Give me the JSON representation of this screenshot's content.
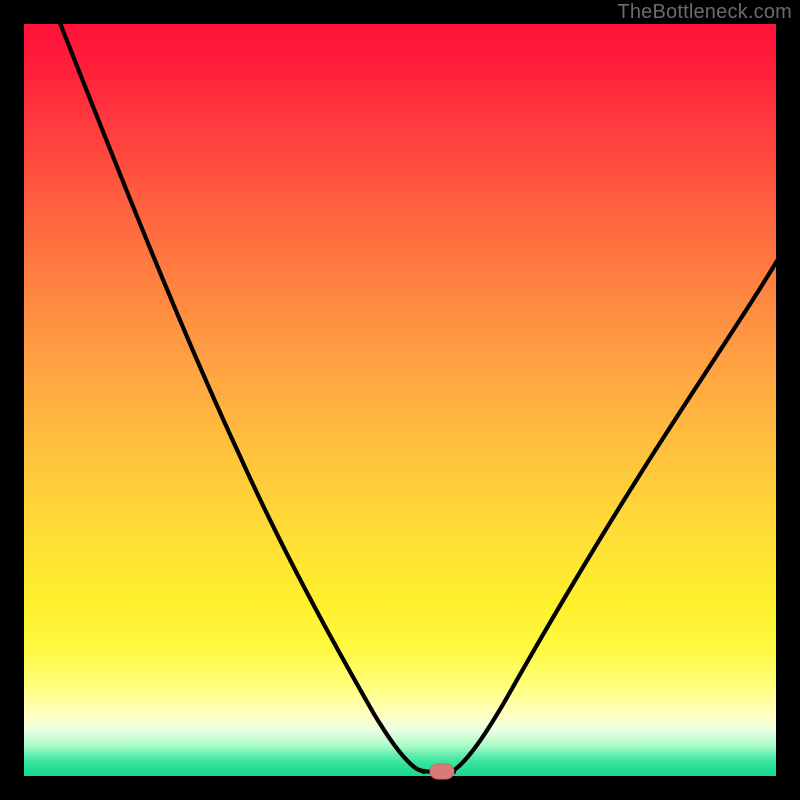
{
  "watermark": "TheBottleneck.com",
  "colors": {
    "frame": "#000000",
    "curve_stroke": "#000000",
    "marker_fill": "#d77a7a",
    "gradient_top": "#ff1239",
    "gradient_bottom": "#1bd98f"
  },
  "chart_data": {
    "type": "line",
    "title": "",
    "xlabel": "",
    "ylabel": "",
    "xlim": [
      0,
      100
    ],
    "ylim": [
      0,
      100
    ],
    "x": [
      0,
      5,
      10,
      15,
      20,
      25,
      30,
      35,
      40,
      45,
      48,
      50,
      52,
      54,
      56,
      58,
      60,
      65,
      70,
      75,
      80,
      85,
      90,
      95,
      100
    ],
    "y_percent_from_top": [
      0,
      11,
      22,
      33,
      43,
      53,
      62,
      71,
      80,
      89,
      94,
      97,
      99,
      100,
      100,
      99,
      96,
      88,
      79,
      70,
      61,
      52,
      44,
      37,
      30
    ],
    "marker": {
      "x": 55,
      "y_from_top": 100
    },
    "note": "y_percent_from_top: 0 = top of plot area, 100 = bottom (green band). Curve descends from top-left, flattens briefly at bottom around x≈53-56, then rises to the right."
  }
}
